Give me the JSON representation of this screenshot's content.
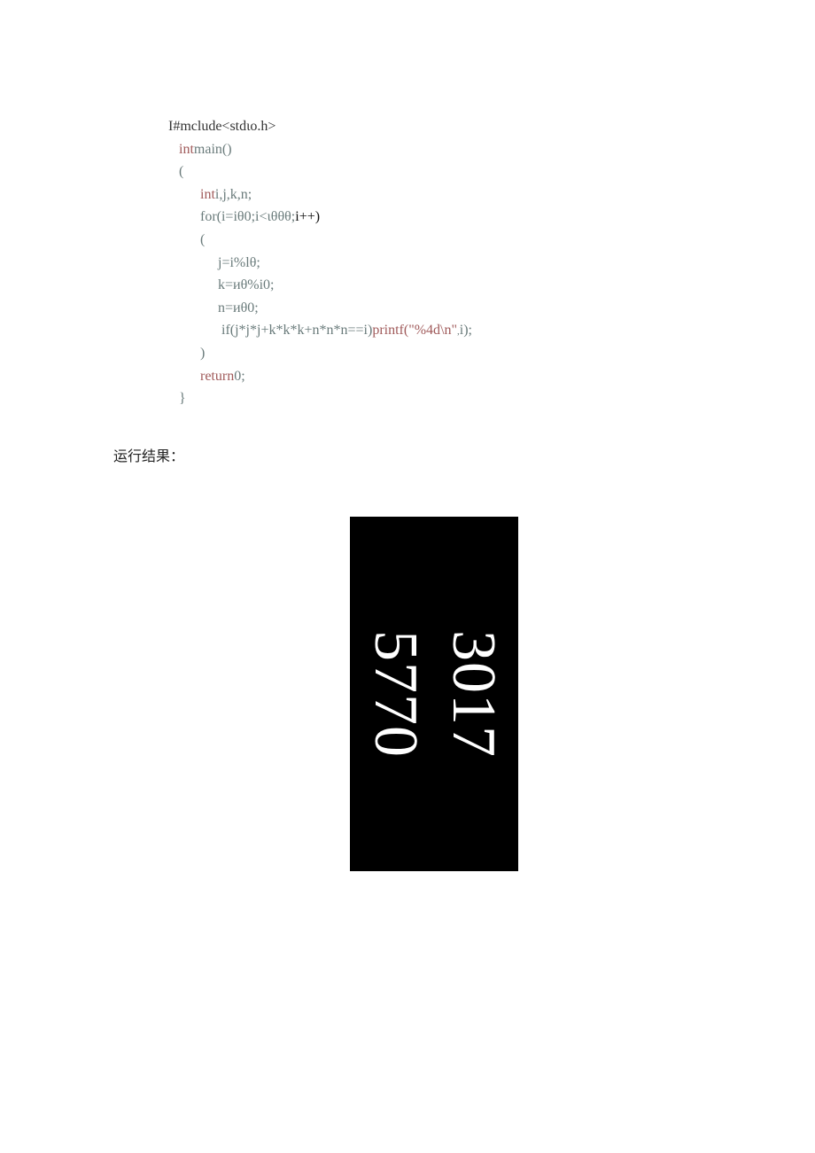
{
  "code": {
    "l0_pre": "I#mclude<stdιo.h>",
    "l1_kw": "int",
    "l1_rest": "main()",
    "l2": "(",
    "l3_kw": "int",
    "l3_rest": "i,j,k,n;",
    "l4_a": "for(i=i",
    "l4_b": "θ",
    "l4_c": "0;i<ι",
    "l4_d": "θθθ",
    "l4_e": ";",
    "l4_f": "i++)",
    "l5": "(",
    "l6": "j=i%l",
    "l6b": "θ",
    "l6c": ";",
    "l7": "k=и",
    "l7b": "θ",
    "l7c": "%i0;",
    "l8": "n=и",
    "l8b": "θ",
    "l8c": "0;",
    "l9_if": "if",
    "l9_cond": "(j*j*j+k*k*k+n*n*n==i)",
    "l9_pf": "printf(\"%4d\\n\"",
    "l9_sub": ",",
    "l9_end": "i);",
    "l10": ")",
    "l11_kw": "return",
    "l11_rest": "0;",
    "l12": "}"
  },
  "label": "运行结果：",
  "output": {
    "line1": "3017",
    "line2": "5770"
  }
}
